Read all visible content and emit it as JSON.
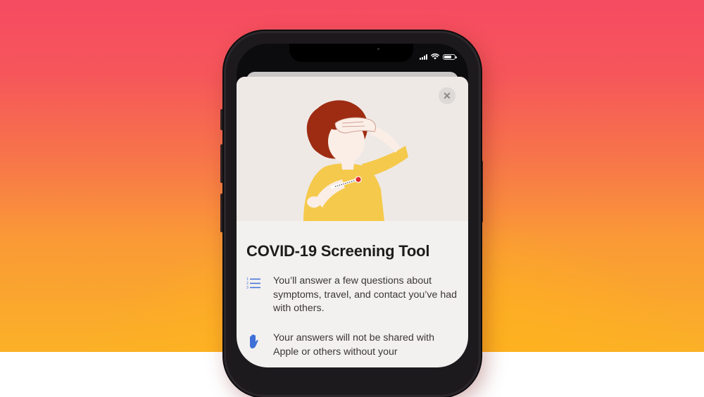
{
  "screen": {
    "title": "COVID-19 Screening Tool",
    "close_icon": "close-icon",
    "items": [
      {
        "icon": "numbered-list-icon",
        "text": "You’ll answer a few questions about symptoms, travel, and contact you’ve had with others."
      },
      {
        "icon": "hand-icon",
        "text": "Your answers will not be shared with Apple or others without your"
      }
    ]
  },
  "colors": {
    "accent": "#3e6fd8",
    "background_top": "#f64b62",
    "background_bottom": "#fbb127",
    "hair": "#9e2c12",
    "shirt": "#f5c94b"
  }
}
